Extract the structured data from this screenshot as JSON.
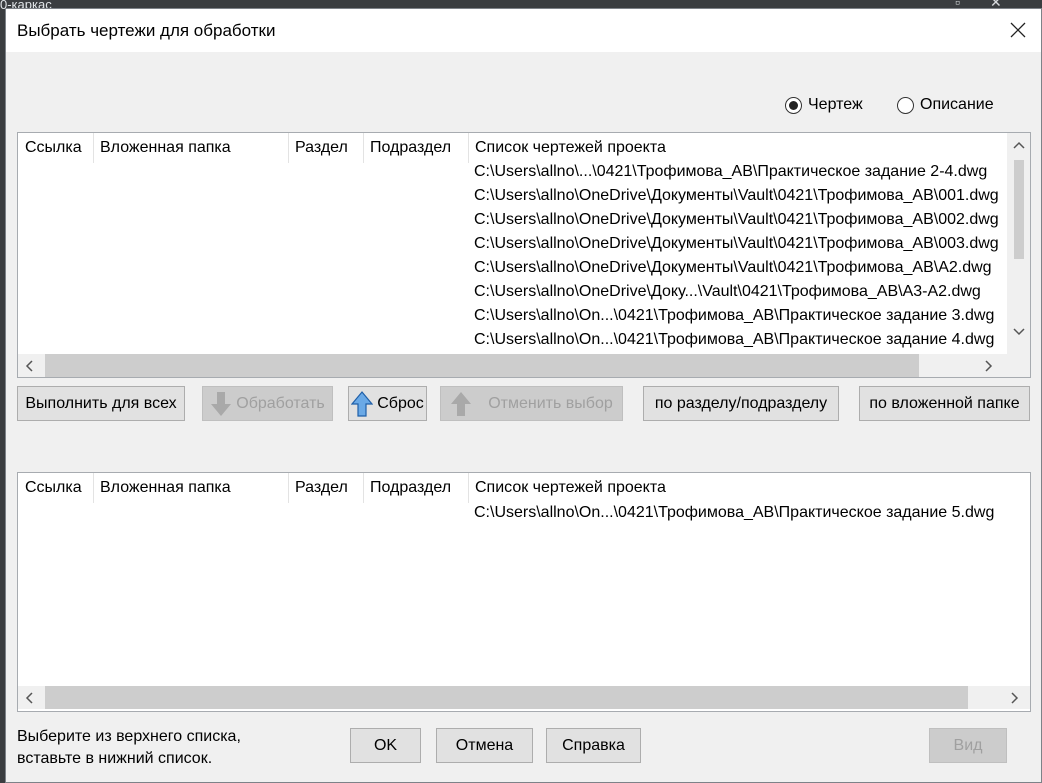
{
  "background": {
    "text": "0-каркас"
  },
  "dialog": {
    "title": "Выбрать чертежи для обработки",
    "close_label": "✕"
  },
  "radios": [
    {
      "label": "Чертеж",
      "checked": true
    },
    {
      "label": "Описание",
      "checked": false
    }
  ],
  "columns": [
    "Ссылка",
    "Вложенная папка",
    "Раздел",
    "Подраздел",
    "Список чертежей проекта"
  ],
  "top_list": {
    "rows": [
      "C:\\Users\\allno\\...\\0421\\Трофимова_АВ\\Практическое задание 2-4.dwg",
      "C:\\Users\\allno\\OneDrive\\Документы\\Vault\\0421\\Трофимова_АВ\\001.dwg",
      "C:\\Users\\allno\\OneDrive\\Документы\\Vault\\0421\\Трофимова_АВ\\002.dwg",
      "C:\\Users\\allno\\OneDrive\\Документы\\Vault\\0421\\Трофимова_АВ\\003.dwg",
      "C:\\Users\\allno\\OneDrive\\Документы\\Vault\\0421\\Трофимова_АВ\\А2.dwg",
      "C:\\Users\\allno\\OneDrive\\Доку...\\Vault\\0421\\Трофимова_АВ\\А3-А2.dwg",
      "C:\\Users\\allno\\On...\\0421\\Трофимова_АВ\\Практическое задание 3.dwg",
      "C:\\Users\\allno\\On...\\0421\\Трофимова_АВ\\Практическое задание 4.dwg"
    ]
  },
  "bottom_list": {
    "rows": [
      "C:\\Users\\allno\\On...\\0421\\Трофимова_АВ\\Практическое задание 5.dwg"
    ]
  },
  "toolbar": {
    "run_all": "Выполнить для всех",
    "process": "Обработать",
    "reset": "Сброс",
    "cancel_selection": "Отменить выбор",
    "by_section": "по разделу/подразделу",
    "by_folder": "по вложенной папке"
  },
  "hint": {
    "line1": "Выберите из верхнего списка,",
    "line2": "вставьте в нижний список."
  },
  "footer": {
    "ok": "OK",
    "cancel": "Отмена",
    "help": "Справка",
    "view": "Вид"
  },
  "colors": {
    "arrow_active": "#3c8ed8",
    "arrow_disabled": "#a9a9a9"
  },
  "icons": {
    "up_arrow": "up-arrow-icon",
    "down_arrow": "down-arrow-icon"
  }
}
